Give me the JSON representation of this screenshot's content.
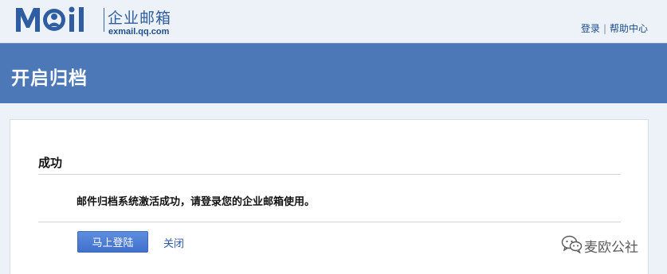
{
  "header": {
    "logo": {
      "mark_text": "MOIL",
      "product_name": "企业邮箱",
      "domain": "exmail.qq.com",
      "brand_color": "#2e5ea1"
    },
    "links": {
      "login": "登录",
      "separator": "|",
      "help": "帮助中心"
    }
  },
  "titlebar": {
    "title": "开启归档",
    "background_color": "#4c78b8"
  },
  "dialog": {
    "section_title": "成功",
    "message": "邮件归档系统激活成功，请登录您的企业邮箱使用。",
    "primary_button": "马上登陆",
    "close_link": "关闭",
    "button_color": "#4a7dd6"
  },
  "watermark": {
    "icon": "wechat-icon",
    "text": "麦欧公社"
  }
}
